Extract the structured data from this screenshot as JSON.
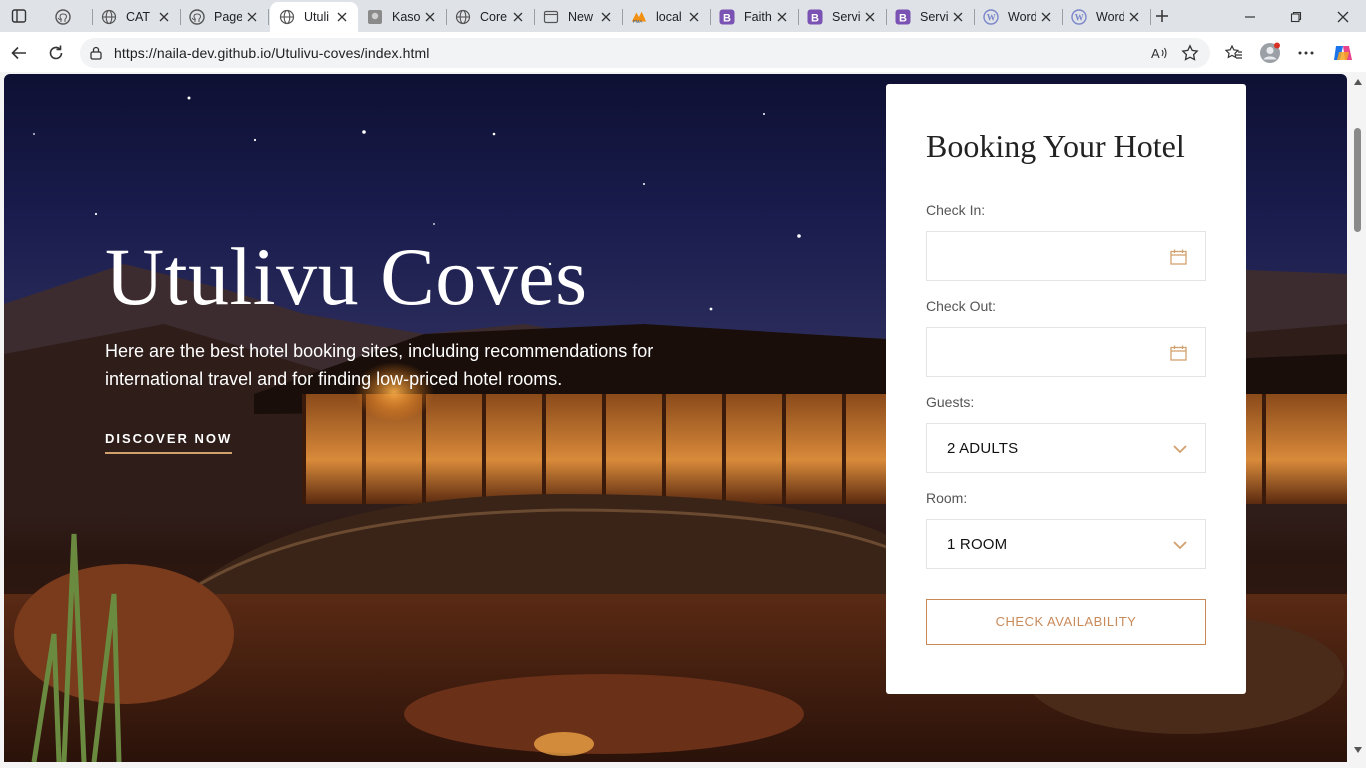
{
  "tabs": [
    {
      "title": "",
      "icon": "github-icon"
    },
    {
      "title": "CAT",
      "icon": "globe-icon"
    },
    {
      "title": "Page",
      "icon": "github-icon"
    },
    {
      "title": "Utuli",
      "icon": "globe-icon",
      "active": true
    },
    {
      "title": "Kaso",
      "icon": "image-icon"
    },
    {
      "title": "Core",
      "icon": "globe-icon"
    },
    {
      "title": "New",
      "icon": "newtab-icon"
    },
    {
      "title": "local",
      "icon": "phpmyadmin-icon"
    },
    {
      "title": "Faith",
      "icon": "bootstrap-icon"
    },
    {
      "title": "Servi",
      "icon": "bootstrap-icon"
    },
    {
      "title": "Servi",
      "icon": "bootstrap-icon"
    },
    {
      "title": "Word",
      "icon": "wordpress-icon"
    },
    {
      "title": "Word",
      "icon": "wordpress-icon"
    }
  ],
  "address_bar": {
    "url": "https://naila-dev.github.io/Utulivu-coves/index.html"
  },
  "hero": {
    "title": "Utulivu Coves",
    "subtitle": "Here are the best hotel booking sites, including recommendations for international travel and for finding low-priced hotel rooms.",
    "cta": "DISCOVER NOW"
  },
  "booking": {
    "heading": "Booking Your Hotel",
    "check_in_label": "Check In:",
    "check_out_label": "Check Out:",
    "guests_label": "Guests:",
    "guests_value": "2 ADULTS",
    "room_label": "Room:",
    "room_value": "1 ROOM",
    "button": "CHECK AVAILABILITY"
  },
  "colors": {
    "accent": "#c98a5a",
    "tab_bar": "#dfe3e8"
  }
}
